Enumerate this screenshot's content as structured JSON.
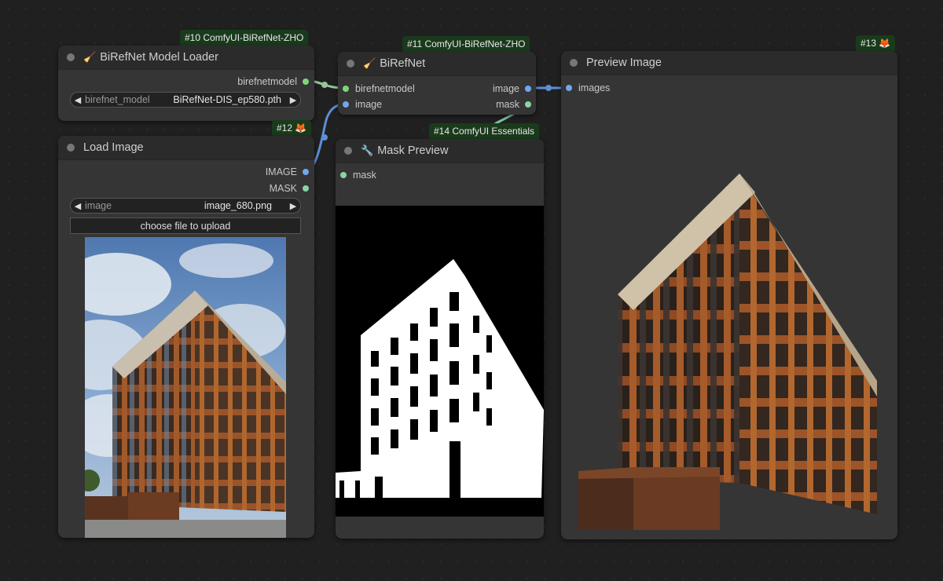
{
  "nodes": {
    "model_loader": {
      "badge": "#10 ComfyUI-BiRefNet-ZHO",
      "icon": "🧹",
      "title": "BiRefNet Model Loader",
      "output": "birefnetmodel",
      "widget": {
        "name": "birefnet_model",
        "value": "BiRefNet-DIS_ep580.pth"
      }
    },
    "load_image": {
      "badge": "#12 🦊",
      "title": "Load Image",
      "outputs": [
        "IMAGE",
        "MASK"
      ],
      "widget": {
        "name": "image",
        "value": "image_680.png"
      },
      "upload_label": "choose file to upload"
    },
    "birefnet": {
      "badge": "#11 ComfyUI-BiRefNet-ZHO",
      "icon": "🧹",
      "title": "BiRefNet",
      "inputs": [
        "birefnetmodel",
        "image"
      ],
      "outputs": [
        "image",
        "mask"
      ]
    },
    "mask_preview": {
      "badge": "#14 ComfyUI Essentials",
      "icon": "🔧",
      "title": "Mask Preview",
      "input": "mask"
    },
    "preview_image": {
      "badge": "#13 🦊",
      "title": "Preview Image",
      "input": "images"
    }
  },
  "colors": {
    "canvas": "#202020",
    "node_body": "#353535",
    "node_title": "#2b2b2b",
    "badge": "#1a3a1c",
    "slot_model": "#7cd67a",
    "slot_image": "#6fa8f0",
    "slot_mask": "#8ad3a5"
  }
}
